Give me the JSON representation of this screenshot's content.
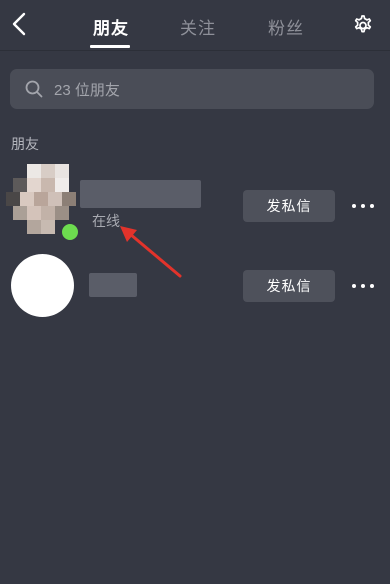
{
  "header": {
    "tabs": [
      {
        "label": "朋友",
        "active": true
      },
      {
        "label": "关注",
        "active": false
      },
      {
        "label": "粉丝",
        "active": false
      }
    ],
    "back_icon": "chevron-left-icon",
    "settings_icon": "gear-icon"
  },
  "search": {
    "placeholder": "23 位朋友",
    "icon": "search-icon"
  },
  "section": {
    "title": "朋友"
  },
  "friends": [
    {
      "status": "在线",
      "online": true,
      "message_label": "发私信",
      "more_icon": "ellipsis-icon"
    },
    {
      "status": "",
      "online": false,
      "message_label": "发私信",
      "more_icon": "ellipsis-icon"
    }
  ],
  "colors": {
    "background": "#353843",
    "online": "#6ddc4f",
    "annotation_arrow": "#e2332b"
  }
}
